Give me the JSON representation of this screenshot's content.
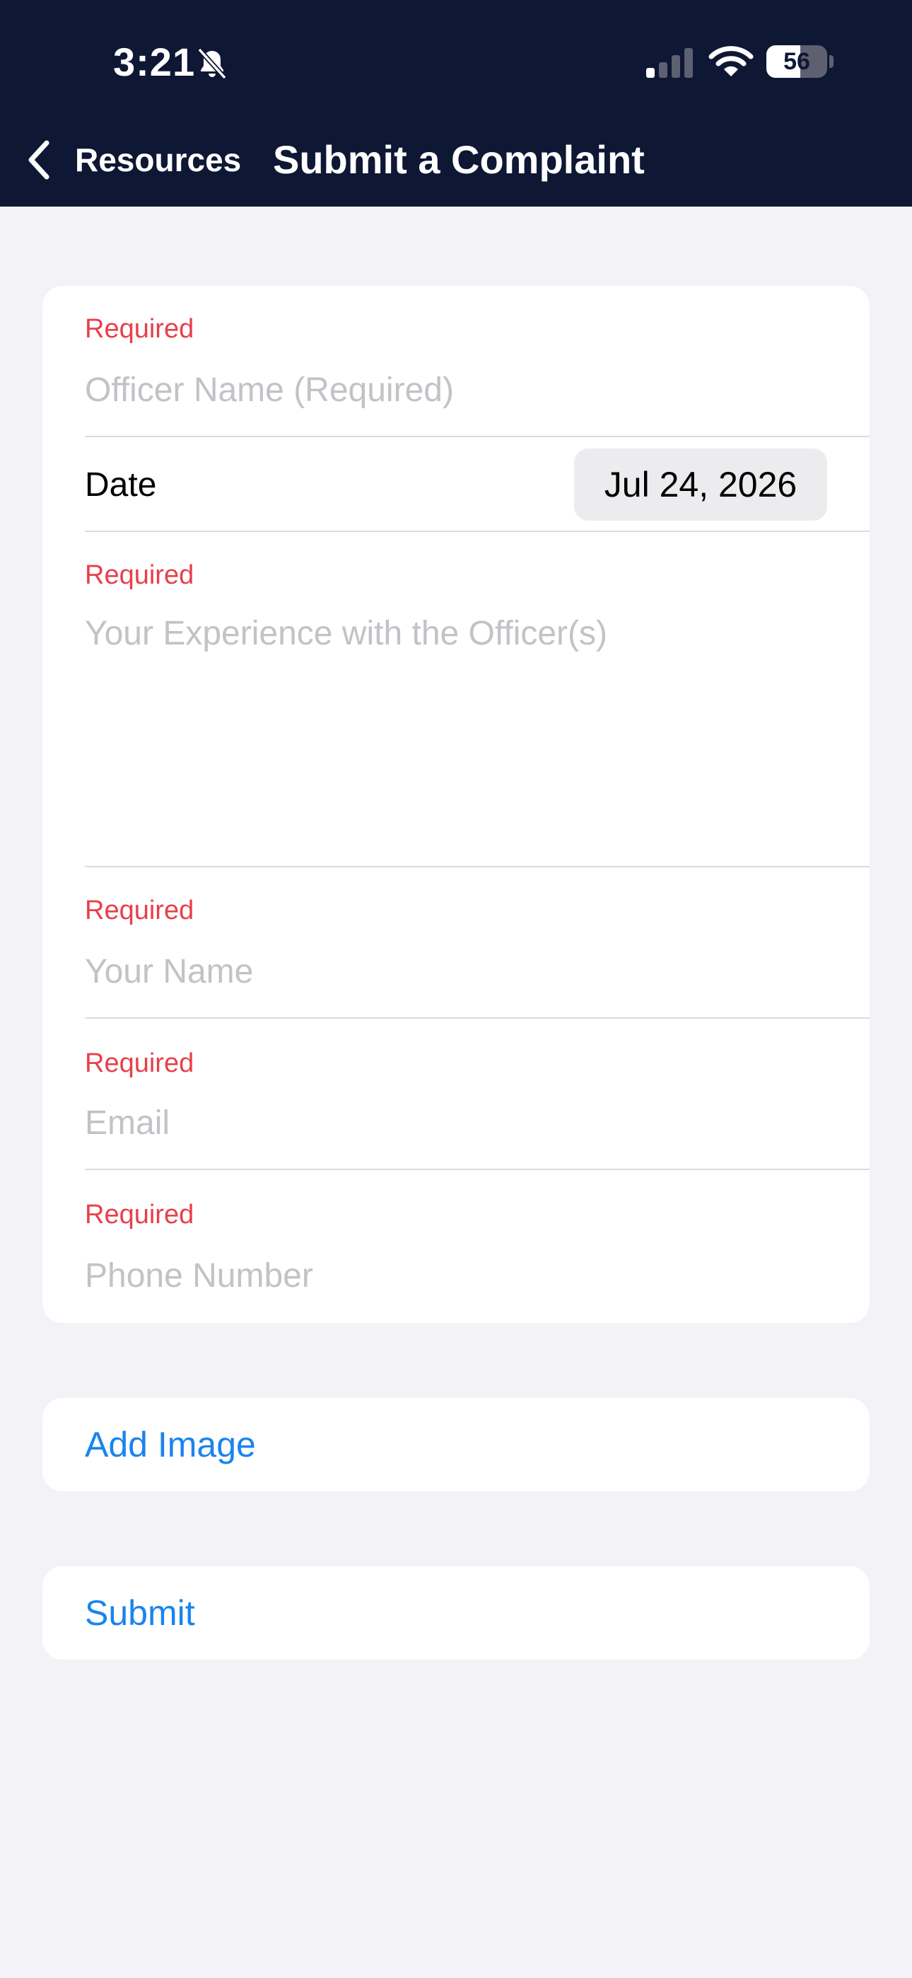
{
  "status_bar": {
    "time": "3:21",
    "battery_level": "56",
    "battery_percent": 56,
    "signal_bars_active": 1,
    "signal_bars_total": 4
  },
  "nav": {
    "back_label": "Resources",
    "title": "Submit a Complaint"
  },
  "form": {
    "officer_name": {
      "required_label": "Required",
      "placeholder": "Officer Name (Required)"
    },
    "date": {
      "label": "Date",
      "value": "Jul 24, 2026"
    },
    "experience": {
      "required_label": "Required",
      "placeholder": "Your Experience with the Officer(s)"
    },
    "your_name": {
      "required_label": "Required",
      "placeholder": "Your Name"
    },
    "email": {
      "required_label": "Required",
      "placeholder": "Email"
    },
    "phone": {
      "required_label": "Required",
      "placeholder": "Phone Number"
    }
  },
  "actions": {
    "add_image": "Add Image",
    "submit": "Submit"
  },
  "colors": {
    "header_bg": "#0e1733",
    "page_bg": "#f2f2f7",
    "required": "#e8404a",
    "placeholder": "#c2c2c7",
    "link": "#1a84ee"
  }
}
